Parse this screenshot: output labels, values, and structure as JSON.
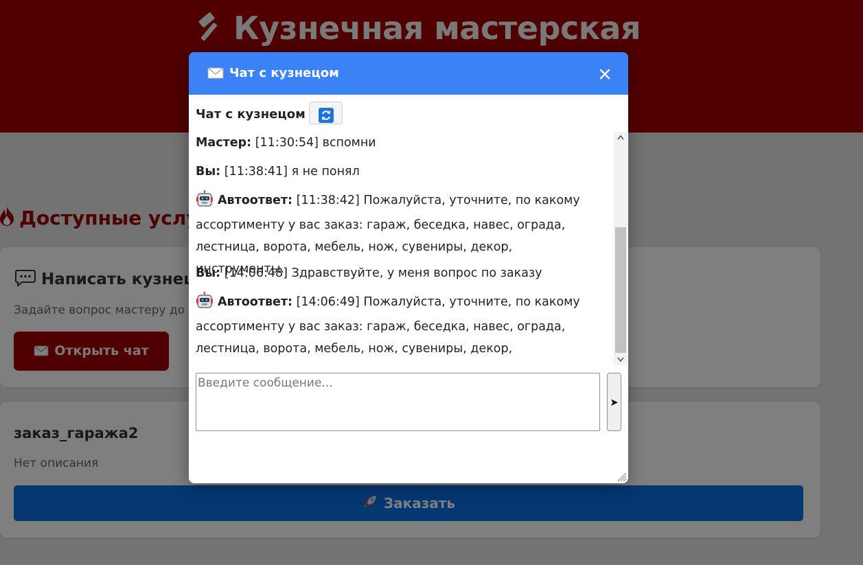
{
  "site": {
    "title": "Кузнечная мастерская",
    "section_title": "Доступные услуги"
  },
  "chat_card": {
    "title": "Написать кузнецу",
    "text": "Задайте вопрос мастеру до или после заказа",
    "button_label": "Открыть чат"
  },
  "order_card": {
    "title": "заказ_гаража2",
    "description": "Нет описания",
    "button_label": "Заказать"
  },
  "modal": {
    "title": "Чат с кузнецом",
    "chat_label": "Чат с кузнецом",
    "input_placeholder": "Введите сообщение...",
    "send_label": "➤",
    "messages": [
      {
        "author": "Мастер:",
        "time": "[11:30:54]",
        "text": "вспомни",
        "bot": false
      },
      {
        "author": "Вы:",
        "time": "[11:38:41]",
        "text": "я не понял",
        "bot": false
      },
      {
        "author": "Автоответ:",
        "time": "[11:38:42]",
        "text": "Пожалуйста, уточните, по какому ассортименту у вас заказ: гараж, беседка, навес, ограда, лестница, ворота, мебель, нож, сувениры, декор, инструменты.",
        "bot": true
      },
      {
        "author": "Вы:",
        "time": "[14:06:48]",
        "text": "Здравствуйте, у меня вопрос по заказу",
        "bot": false
      },
      {
        "author": "Автоответ:",
        "time": "[14:06:49]",
        "text": "Пожалуйста, уточните, по какому ассортименту у вас заказ: гараж, беседка, навес, ограда, лестница, ворота, мебель, нож, сувениры, декор, инструменты.",
        "bot": true
      }
    ]
  },
  "colors": {
    "header_bg": "#a00000",
    "modal_header": "#3b82f6",
    "order_button": "#0a6ee6"
  }
}
